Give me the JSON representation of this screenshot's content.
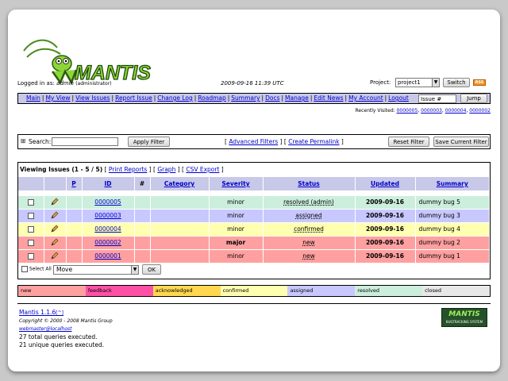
{
  "header": {
    "logo_text": "MANTIS",
    "logged_in_prefix": "Logged in as:",
    "username": "admin",
    "role": "(administrator)",
    "datetime": "2009-09-16 11:39 UTC",
    "project_label": "Project:",
    "project_value": "project1",
    "switch_label": "Switch",
    "rss_label": "RSS"
  },
  "menu": {
    "items": [
      "Main",
      "My View",
      "View Issues",
      "Report Issue",
      "Change Log",
      "Roadmap",
      "Summary",
      "Docs",
      "Manage",
      "Edit News",
      "My Account",
      "Logout"
    ],
    "issue_placeholder": "Issue #",
    "jump_label": "Jump"
  },
  "recent": {
    "label": "Recently Visited:",
    "items": [
      "0000005",
      "0000003",
      "0000004",
      "0000002"
    ]
  },
  "filter": {
    "toggle": "⊞",
    "search_label": "Search:",
    "apply_label": "Apply Filter",
    "advanced_label": "Advanced Filters",
    "permalink_label": "Create Permalink",
    "reset_label": "Reset Filter",
    "save_label": "Save Current Filter"
  },
  "issues": {
    "title": "Viewing Issues (1 - 5 / 5)",
    "print_label": "Print Reports",
    "graph_label": "Graph",
    "csv_label": "CSV Export",
    "columns": [
      "",
      "",
      "P",
      "ID",
      "#",
      "Category",
      "Severity",
      "Status",
      "Updated",
      "Summary"
    ],
    "rows": [
      {
        "id": "0000005",
        "severity": "minor",
        "status": "resolved (admin)",
        "updated": "2009-09-16",
        "summary": "dummy bug 5",
        "color": "#cceedd"
      },
      {
        "id": "0000003",
        "severity": "minor",
        "status": "assigned",
        "updated": "2009-09-16",
        "summary": "dummy bug 3",
        "color": "#c8c8ff"
      },
      {
        "id": "0000004",
        "severity": "minor",
        "status": "confirmed",
        "updated": "2009-09-16",
        "summary": "dummy bug 4",
        "color": "#ffffb0"
      },
      {
        "id": "0000002",
        "severity": "major",
        "status": "new",
        "updated": "2009-09-16",
        "summary": "dummy bug 2",
        "color": "#ffa0a0"
      },
      {
        "id": "0000001",
        "severity": "minor",
        "status": "new",
        "updated": "2009-09-16",
        "summary": "dummy bug 1",
        "color": "#ffa0a0"
      }
    ],
    "select_all_label": "Select All",
    "action_value": "Move",
    "ok_label": "OK"
  },
  "legend": [
    {
      "label": "new",
      "color": "#ffa0a0"
    },
    {
      "label": "feedback",
      "color": "#ff50a8"
    },
    {
      "label": "acknowledged",
      "color": "#ffd850"
    },
    {
      "label": "confirmed",
      "color": "#ffffb0"
    },
    {
      "label": "assigned",
      "color": "#c8c8ff"
    },
    {
      "label": "resolved",
      "color": "#cceedd"
    },
    {
      "label": "closed",
      "color": "#e8e8e8"
    }
  ],
  "footer": {
    "version": "Mantis 1.1.6",
    "version_suffix": "[^]",
    "copyright": "Copyright © 2000 - 2008 Mantis Group",
    "email": "webmaster@localhost",
    "queries_total": "27 total queries executed.",
    "queries_unique": "21 unique queries executed.",
    "badge_text": "MANTIS",
    "badge_sub": "BUGTRACKING SYSTEM"
  }
}
